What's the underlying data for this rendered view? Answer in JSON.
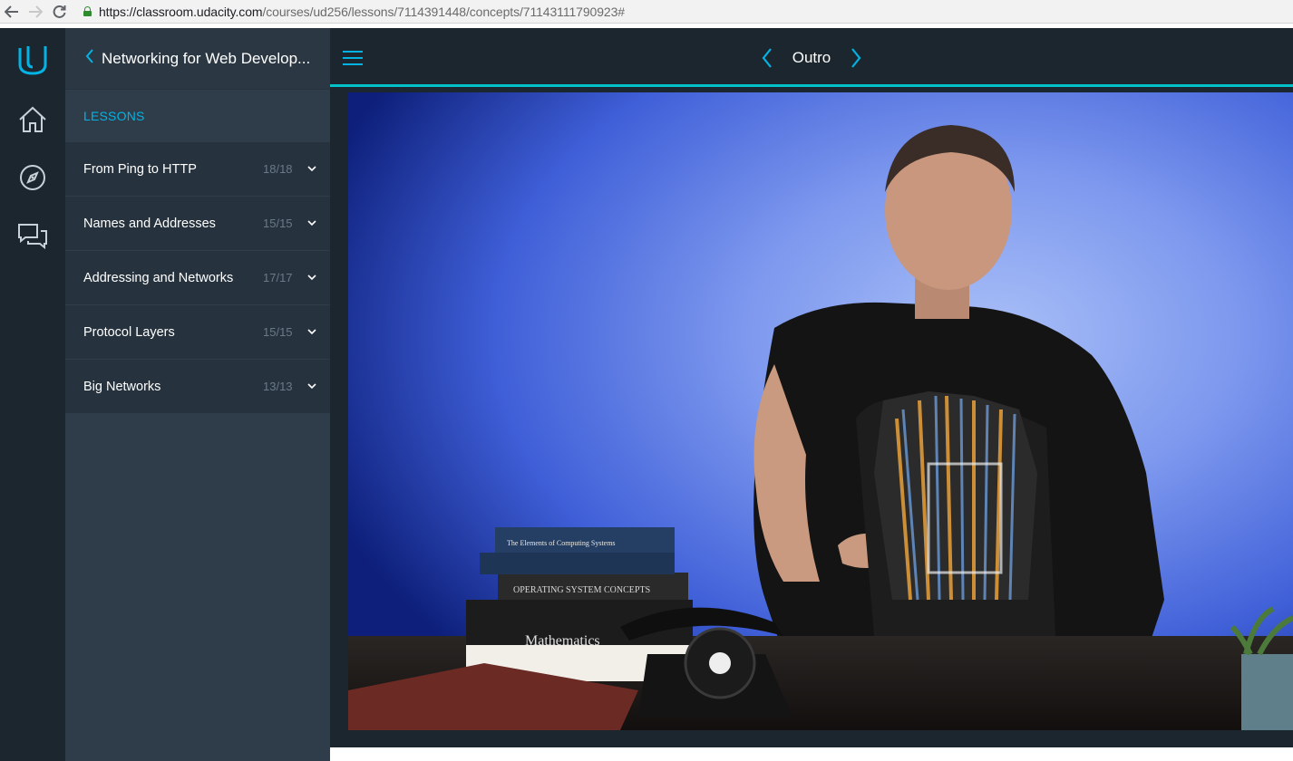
{
  "browser": {
    "url_host": "https://classroom.udacity.com",
    "url_path": "/courses/ud256/lessons/7114391448/concepts/71143111790923#"
  },
  "rail": {
    "items": [
      {
        "icon": "udacity-logo-icon"
      },
      {
        "icon": "home-icon"
      },
      {
        "icon": "compass-icon"
      },
      {
        "icon": "chat-icon"
      }
    ]
  },
  "sidebar": {
    "course_title": "Networking for Web Develop...",
    "lessons_label": "LESSONS",
    "lessons": [
      {
        "title": "From Ping to HTTP",
        "count": "18/18"
      },
      {
        "title": "Names and Addresses",
        "count": "15/15"
      },
      {
        "title": "Addressing and Networks",
        "count": "17/17"
      },
      {
        "title": "Protocol Layers",
        "count": "15/15"
      },
      {
        "title": "Big Networks",
        "count": "13/13"
      }
    ]
  },
  "main": {
    "concept_title": "Outro",
    "video": {
      "book_titles": [
        "The Elements of Computing Systems",
        "OPERATING SYSTEM CONCEPTS",
        "Mathematics"
      ]
    }
  },
  "colors": {
    "accent": "#02b3e4",
    "progress": "#02c1c9",
    "rail_bg": "#1c262f",
    "sidebar_bg": "#2f3d4a"
  }
}
